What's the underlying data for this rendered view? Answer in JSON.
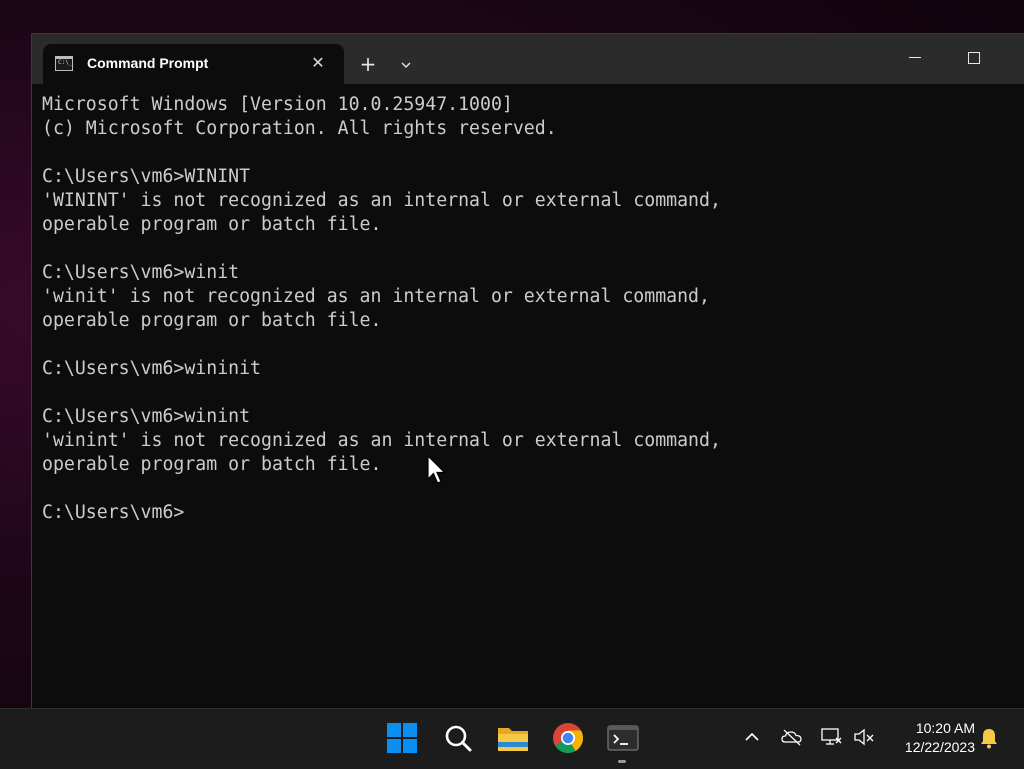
{
  "window": {
    "tab_title": "Command Prompt",
    "tab_icon_text": "C:\\_",
    "new_tab_label": "+",
    "close_tab_label": "✕"
  },
  "console": {
    "lines": [
      "Microsoft Windows [Version 10.0.25947.1000]",
      "(c) Microsoft Corporation. All rights reserved.",
      "",
      "C:\\Users\\vm6>WININT",
      "'WININT' is not recognized as an internal or external command,",
      "operable program or batch file.",
      "",
      "C:\\Users\\vm6>winit",
      "'winit' is not recognized as an internal or external command,",
      "operable program or batch file.",
      "",
      "C:\\Users\\vm6>wininit",
      "",
      "C:\\Users\\vm6>winint",
      "'winint' is not recognized as an internal or external command,",
      "operable program or batch file.",
      "",
      "C:\\Users\\vm6>"
    ]
  },
  "taskbar": {
    "icons": [
      "windows-start-icon",
      "search-icon",
      "file-explorer-icon",
      "chrome-icon",
      "terminal-icon"
    ],
    "tray_icons": [
      "chevron-up-icon",
      "onedrive-icon",
      "network-icon",
      "volume-muted-icon",
      "notification-bell-icon"
    ],
    "time": "10:20 AM",
    "date": "12/22/2023"
  },
  "colors": {
    "console_bg": "#0c0c0c",
    "console_text": "#cccccc",
    "titlebar_bg": "#2b2b2b",
    "taskbar_bg": "#1c1c1c",
    "windows_blue": "#0a8ff0"
  }
}
